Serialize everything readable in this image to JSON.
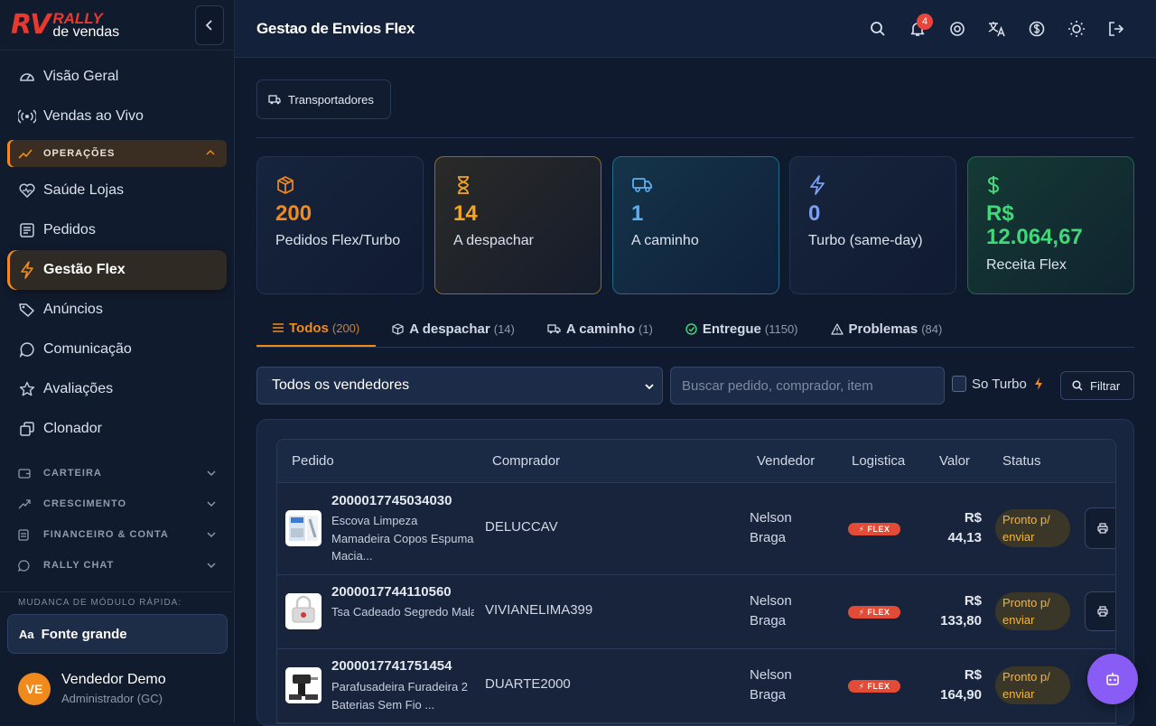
{
  "brand": {
    "logo_mark": "RV",
    "logo_top": "RALLY",
    "logo_bottom": "de vendas"
  },
  "sidebar": {
    "items_top": [
      {
        "label": "Visão Geral",
        "icon": "gauge-icon"
      },
      {
        "label": "Vendas ao Vivo",
        "icon": "broadcast-icon"
      }
    ],
    "section_open": {
      "label": "OPERAÇÕES",
      "icon": "trend-icon"
    },
    "items_ops": [
      {
        "label": "Saúde Lojas",
        "icon": "heart-pulse-icon"
      },
      {
        "label": "Pedidos",
        "icon": "list-icon"
      },
      {
        "label": "Gestão Flex",
        "icon": "bolt-icon"
      },
      {
        "label": "Anúncios",
        "icon": "tag-icon"
      },
      {
        "label": "Comunicação",
        "icon": "chat-icon"
      },
      {
        "label": "Avaliações",
        "icon": "star-icon"
      },
      {
        "label": "Clonador",
        "icon": "copy-icon"
      }
    ],
    "sections": [
      {
        "label": "CARTEIRA",
        "icon": "wallet-icon"
      },
      {
        "label": "CRESCIMENTO",
        "icon": "growth-icon"
      },
      {
        "label": "FINANCEIRO & CONTA",
        "icon": "file-icon"
      },
      {
        "label": "RALLY CHAT",
        "icon": "whatsapp-icon"
      }
    ],
    "quick_switch_label": "MUDANCA DE MÓDULO RÁPIDA:",
    "font_button": {
      "icon_text": "Aa",
      "label": "Fonte grande"
    },
    "user": {
      "initials": "VE",
      "name": "Vendedor Demo",
      "role": "Administrador (GC)"
    }
  },
  "header": {
    "title": "Gestao de Envios Flex",
    "notification_count": "4"
  },
  "toolbar": {
    "carriers_label": "Transportadores"
  },
  "cards": [
    {
      "value": "200",
      "label": "Pedidos Flex/Turbo",
      "icon": "box-icon",
      "color": "#f08a1c"
    },
    {
      "value": "14",
      "label": "A despachar",
      "icon": "hourglass-icon",
      "color": "#f5a524"
    },
    {
      "value": "1",
      "label": "A caminho",
      "icon": "truck-icon",
      "color": "#5ab0f0"
    },
    {
      "value": "0",
      "label": "Turbo (same-day)",
      "icon": "bolt-icon",
      "color": "#7b9ff5"
    },
    {
      "value": "R$ 12.064,67",
      "label": "Receita Flex",
      "icon": "dollar-icon",
      "color": "#3fd97a"
    }
  ],
  "tabs": [
    {
      "label": "Todos",
      "count": "(200)"
    },
    {
      "label": "A despachar",
      "count": "(14)"
    },
    {
      "label": "A caminho",
      "count": "(1)"
    },
    {
      "label": "Entregue",
      "count": "(1150)"
    },
    {
      "label": "Problemas",
      "count": "(84)"
    }
  ],
  "filters": {
    "seller_select": "Todos os vendedores",
    "search_placeholder": "Buscar pedido, comprador, item",
    "turbo_label": "So Turbo",
    "filter_button": "Filtrar"
  },
  "table": {
    "headers": [
      "Pedido",
      "Comprador",
      "Vendedor",
      "Logistica",
      "Valor",
      "Status"
    ],
    "rows": [
      {
        "order_id": "2000017745034030",
        "item": "Escova Limpeza Mamadeira Copos Espuma Macia...",
        "buyer": "DELUCCAV",
        "seller": "Nelson Braga",
        "logistics": "FLEX",
        "value_currency": "R$",
        "value_amount": "44,13",
        "status": "Pronto p/ enviar"
      },
      {
        "order_id": "2000017744110560",
        "item": "Tsa Cadeado Segredo Mala Armario Vestiario ...",
        "buyer": "VIVIANELIMA399",
        "seller": "Nelson Braga",
        "logistics": "FLEX",
        "value_currency": "R$",
        "value_amount": "133,80",
        "status": "Pronto p/ enviar"
      },
      {
        "order_id": "2000017741751454",
        "item": "Parafusadeira Furadeira 2 Baterias Sem Fio ...",
        "buyer": "DUARTE2000",
        "seller": "Nelson Braga",
        "logistics": "FLEX",
        "value_currency": "R$",
        "value_amount": "164,90",
        "status": "Pronto p/ enviar"
      }
    ]
  },
  "colors": {
    "accent": "#f08a1c",
    "background": "#0f1a2e",
    "fab": "#8a5cf6",
    "flex_badge": "#e24c36",
    "status_text": "#f3b443"
  }
}
